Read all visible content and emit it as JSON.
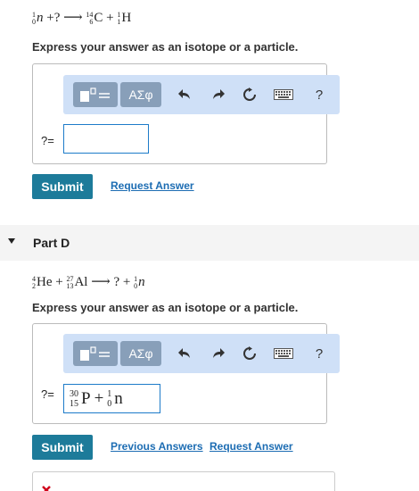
{
  "part_c": {
    "equation": {
      "reactant1": {
        "mass": "1",
        "atomic": "0",
        "symbol": "n"
      },
      "plus1": "+",
      "unknown": "?",
      "arrow": "⟶",
      "product1": {
        "mass": "14",
        "atomic": "6",
        "symbol": "C"
      },
      "plus2": "+",
      "product2": {
        "mass": "1",
        "atomic": "1",
        "symbol": "H"
      }
    },
    "prompt": "Express your answer as an isotope or a particle.",
    "answer_label": "?=",
    "answer_value": "",
    "submit_label": "Submit",
    "request_answer_label": "Request Answer"
  },
  "toolbar": {
    "greek_label": "ΑΣφ",
    "help_label": "?",
    "icons": [
      "template-icon",
      "undo-icon",
      "redo-icon",
      "reset-icon",
      "keyboard-icon",
      "help-icon"
    ]
  },
  "part_d": {
    "header": "Part D",
    "equation": {
      "reactant1": {
        "mass": "4",
        "atomic": "2",
        "symbol": "He"
      },
      "plus1": "+",
      "reactant2": {
        "mass": "27",
        "atomic": "13",
        "symbol": "Al"
      },
      "arrow": "⟶",
      "unknown": "?",
      "plus2": "+",
      "product2": {
        "mass": "1",
        "atomic": "0",
        "symbol": "n"
      }
    },
    "prompt": "Express your answer as an isotope or a particle.",
    "answer_label": "?=",
    "answer": {
      "p_mass": "30",
      "p_atomic": "15",
      "p_symbol": "P",
      "plus": "+",
      "n_mass": "1",
      "n_atomic": "0",
      "n_symbol": "n"
    },
    "submit_label": "Submit",
    "previous_answers_label": "Previous Answers",
    "request_answer_label": "Request Answer"
  },
  "colors": {
    "accent": "#1d7b9a",
    "link": "#1d6db3",
    "toolbar": "#cfe0f7",
    "error": "#d0021b"
  }
}
